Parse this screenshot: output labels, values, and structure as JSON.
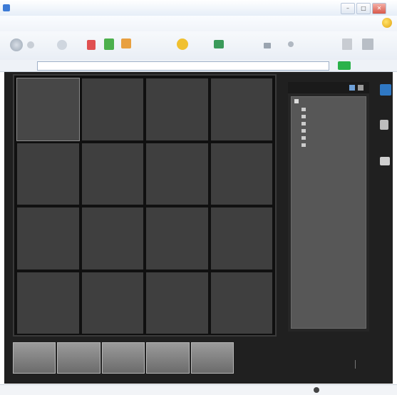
{
  "window": {
    "title": "",
    "controls": {
      "minimize": "–",
      "maximize": "□",
      "close": "✕"
    }
  },
  "menubar": {
    "items": [
      "",
      "",
      "",
      "",
      "",
      ""
    ]
  },
  "addressbar": {
    "label": "",
    "url": "",
    "links": ""
  },
  "app": {
    "grid": {
      "rows": 4,
      "cols": 4,
      "selected_cell": 0
    },
    "panel": {
      "title": "",
      "root": "",
      "items": [
        "",
        "",
        "",
        "",
        "",
        ""
      ]
    },
    "tabs": [
      "",
      "",
      "",
      "",
      ""
    ],
    "status_right": ""
  },
  "statusbar": {
    "left": "",
    "zone": ""
  },
  "icons": {
    "browser": "ie-icon",
    "back": "back-arrow-icon",
    "forward": "forward-arrow-icon",
    "go": "go-arrow-icon",
    "camera": "camera-icon"
  },
  "colors": {
    "app_bg": "#202020",
    "cell": "#3f3f3f",
    "panel": "#575757",
    "accent": "#2f78c4"
  }
}
